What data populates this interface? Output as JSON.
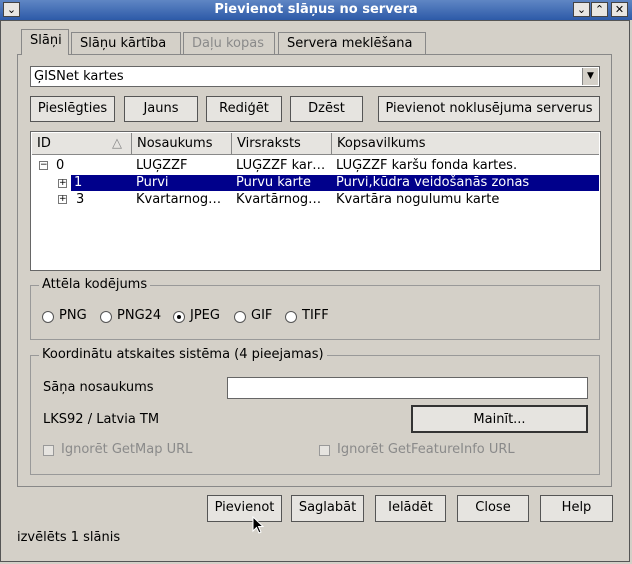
{
  "window": {
    "title": "Pievienot slāņus no servera",
    "menu_glyph": "⌄",
    "minimize_glyph": "⌄",
    "maximize_glyph": "⌃",
    "close_glyph": "✕"
  },
  "tabs": [
    {
      "label": "Slāņi",
      "state": "active"
    },
    {
      "label": "Slāņu kārtība",
      "state": "normal"
    },
    {
      "label": "Daļu kopas",
      "state": "disabled"
    },
    {
      "label": "Servera meklēšana",
      "state": "normal"
    }
  ],
  "server_select": {
    "value": "ĢISNet kartes",
    "arrow": "▼"
  },
  "connection_buttons": {
    "connect": "Pieslēgties",
    "new": "Jauns",
    "edit": "Rediģēt",
    "delete": "Dzēst",
    "add_default": "Pievienot noklusējuma serverus"
  },
  "layers_table": {
    "columns": {
      "id": "ID",
      "name": "Nosaukums",
      "title": "Virsraksts",
      "abstract": "Kopsavilkums"
    },
    "sort_indicator": "△",
    "rows": [
      {
        "id": "0",
        "name": "LUĢZZF",
        "title": "LUĢZZF kar…",
        "abstract": "LUĢZZF karšu fonda kartes.",
        "expander": "−",
        "selected": false
      },
      {
        "id": "1",
        "name": "Purvi",
        "title": "Purvu karte",
        "abstract": "Purvi,kūdra veidošanās zonas",
        "expander": "+",
        "selected": true
      },
      {
        "id": "3",
        "name": "Kvartarnog…",
        "title": "Kvartārnog…",
        "abstract": "Kvartāra nogulumu karte",
        "expander": "+",
        "selected": false
      }
    ]
  },
  "image_encoding": {
    "legend": "Attēla kodējums",
    "options": [
      "PNG",
      "PNG24",
      "JPEG",
      "GIF",
      "TIFF"
    ],
    "selected": "JPEG"
  },
  "crs": {
    "legend": "Koordinātu atskaites sistēma (4 pieejamas)",
    "layer_name_label": "Sāņa nosaukums",
    "layer_name_value": "",
    "current": "LKS92 / Latvia TM",
    "change_button": "Mainīt...",
    "ignore_getmap": "Ignorēt GetMap URL",
    "ignore_getfeatureinfo": "Ignorēt GetFeatureInfo URL"
  },
  "footer_buttons": {
    "add": "Pievienot",
    "save": "Saglabāt",
    "load": "Ielādēt",
    "close": "Close",
    "help": "Help"
  },
  "status": {
    "text": "izvēlēts 1 slānis"
  }
}
